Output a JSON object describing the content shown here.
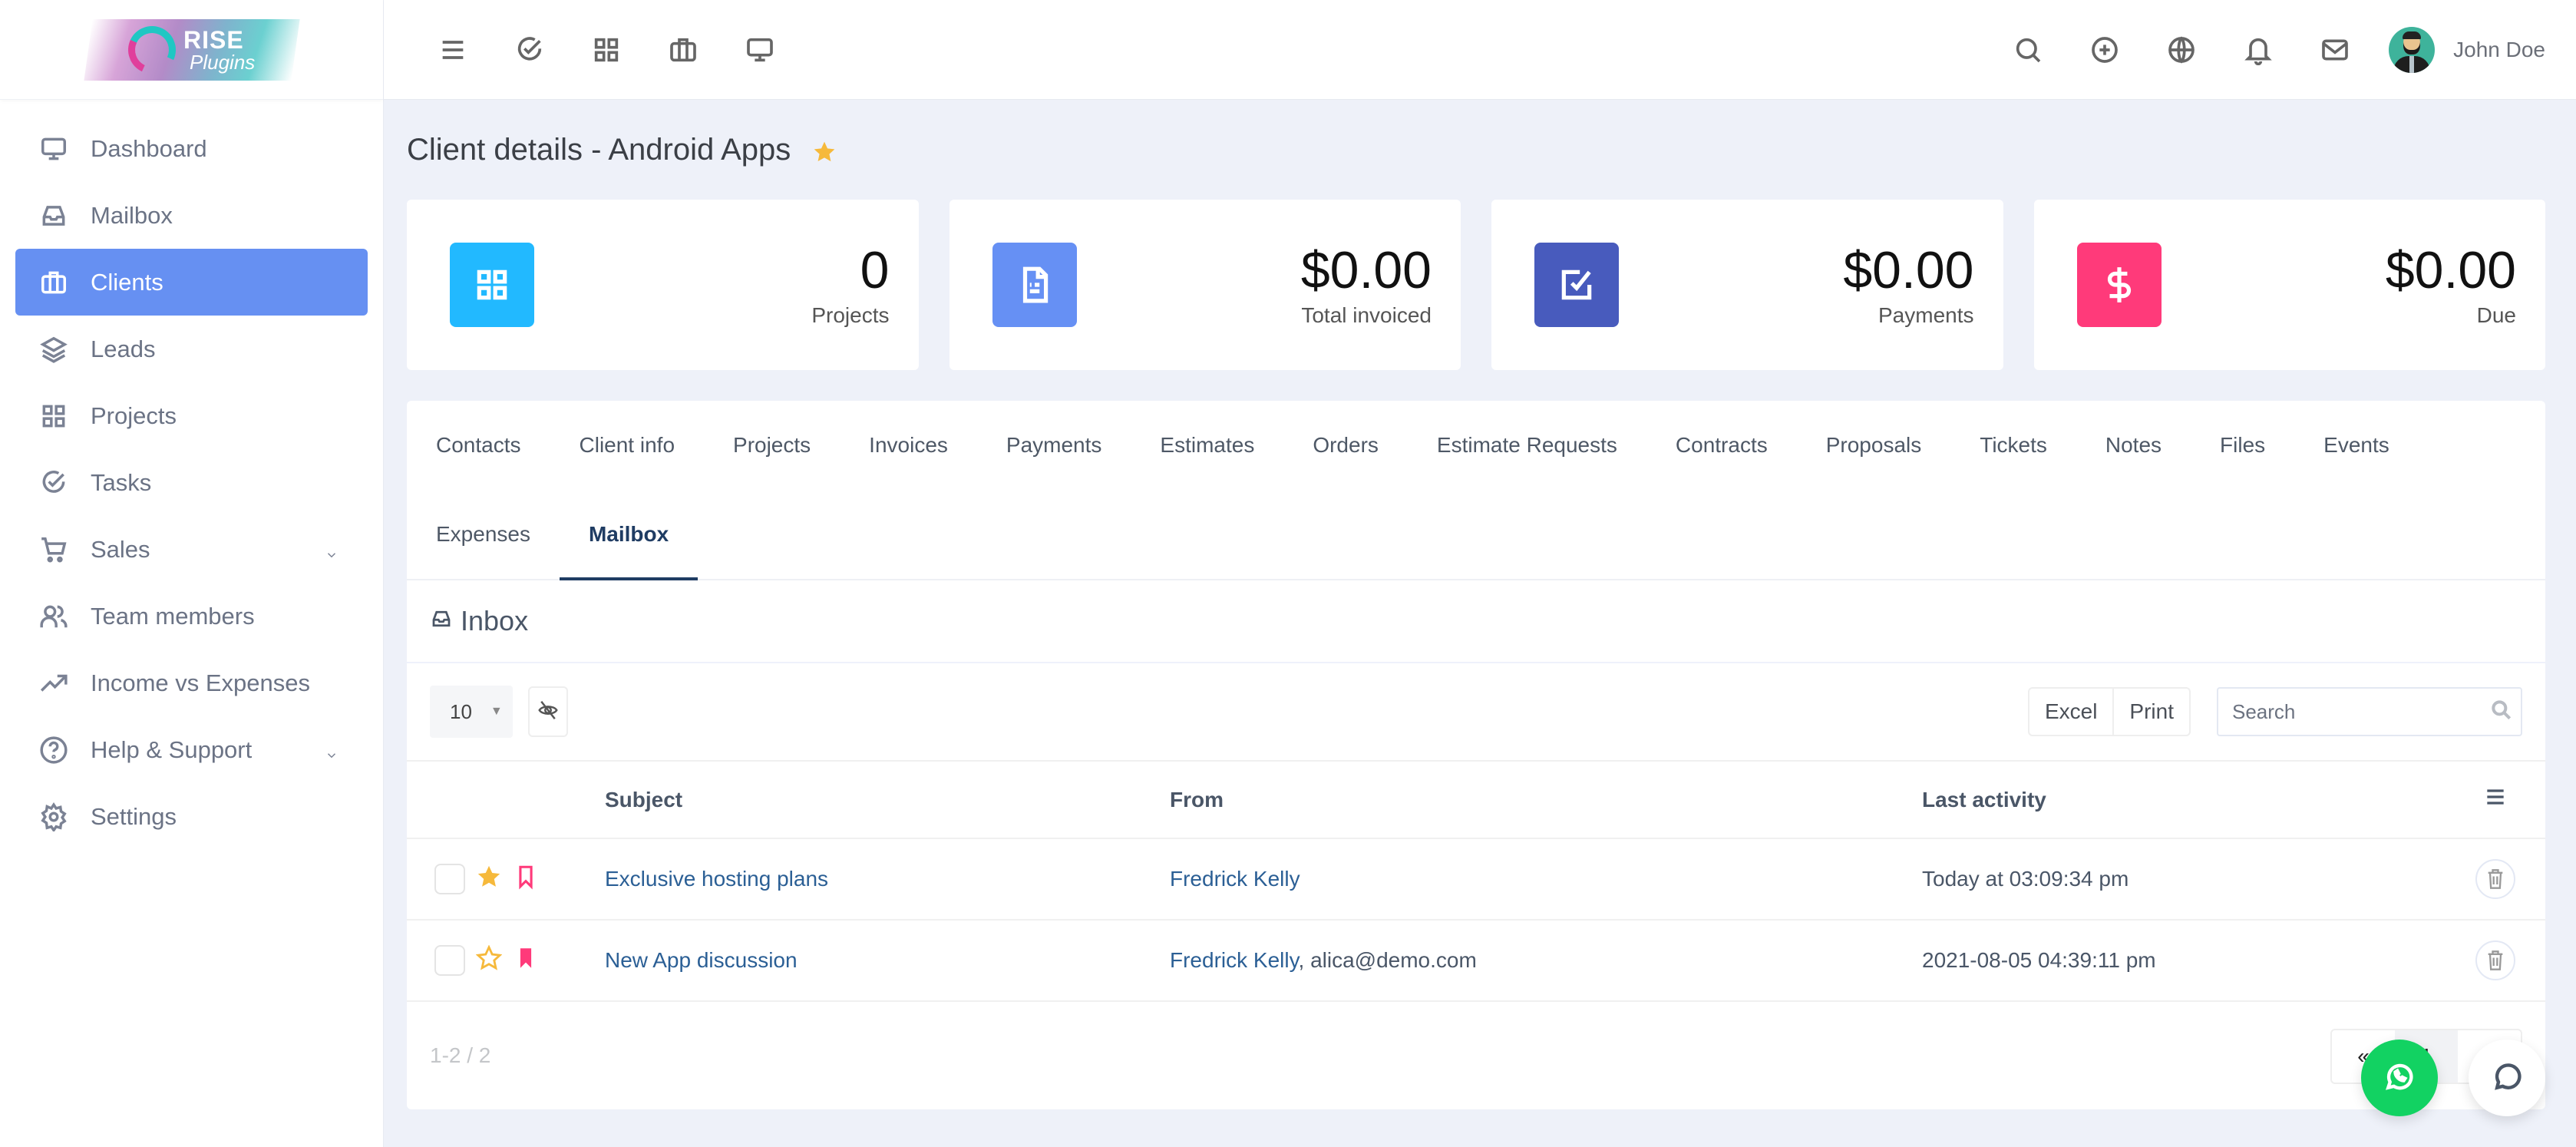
{
  "brand": {
    "line1": "RISE",
    "line2": "Plugins"
  },
  "sidebar": {
    "items": [
      {
        "label": "Dashboard",
        "icon": "monitor-icon",
        "active": false
      },
      {
        "label": "Mailbox",
        "icon": "inbox-icon",
        "active": false
      },
      {
        "label": "Clients",
        "icon": "briefcase-icon",
        "active": true
      },
      {
        "label": "Leads",
        "icon": "layers-icon",
        "active": false
      },
      {
        "label": "Projects",
        "icon": "grid-icon",
        "active": false
      },
      {
        "label": "Tasks",
        "icon": "check-circle-icon",
        "active": false
      },
      {
        "label": "Sales",
        "icon": "cart-icon",
        "active": false,
        "has_submenu": true
      },
      {
        "label": "Team members",
        "icon": "users-icon",
        "active": false
      },
      {
        "label": "Income vs Expenses",
        "icon": "trending-up-icon",
        "active": false
      },
      {
        "label": "Help & Support",
        "icon": "help-circle-icon",
        "active": false,
        "has_submenu": true
      },
      {
        "label": "Settings",
        "icon": "gear-icon",
        "active": false
      }
    ]
  },
  "topbar": {
    "left_icons": [
      "menu-icon",
      "check-circle-icon",
      "grid-icon",
      "briefcase-icon",
      "monitor-icon"
    ],
    "right_icons": [
      "search-icon",
      "plus-circle-icon",
      "globe-icon",
      "bell-icon",
      "mail-icon"
    ],
    "user_name": "John Doe"
  },
  "page": {
    "title": "Client details - Android Apps",
    "favorite": true
  },
  "stats": [
    {
      "value": "0",
      "label": "Projects",
      "icon": "grid-icon",
      "color": "#22b9ff"
    },
    {
      "value": "$0.00",
      "label": "Total invoiced",
      "icon": "file-text-icon",
      "color": "#6690f4"
    },
    {
      "value": "$0.00",
      "label": "Payments",
      "icon": "check-square-icon",
      "color": "#485bbd"
    },
    {
      "value": "$0.00",
      "label": "Due",
      "icon": "dollar-icon",
      "color": "#ff3a7a"
    }
  ],
  "tabs": [
    {
      "label": "Contacts",
      "active": false
    },
    {
      "label": "Client info",
      "active": false
    },
    {
      "label": "Projects",
      "active": false
    },
    {
      "label": "Invoices",
      "active": false
    },
    {
      "label": "Payments",
      "active": false
    },
    {
      "label": "Estimates",
      "active": false
    },
    {
      "label": "Orders",
      "active": false
    },
    {
      "label": "Estimate Requests",
      "active": false
    },
    {
      "label": "Contracts",
      "active": false
    },
    {
      "label": "Proposals",
      "active": false
    },
    {
      "label": "Tickets",
      "active": false
    },
    {
      "label": "Notes",
      "active": false
    },
    {
      "label": "Files",
      "active": false
    },
    {
      "label": "Events",
      "active": false
    },
    {
      "label": "Expenses",
      "active": false
    },
    {
      "label": "Mailbox",
      "active": true
    }
  ],
  "inbox": {
    "title": "Inbox",
    "page_size": "10",
    "excel_label": "Excel",
    "print_label": "Print",
    "search_placeholder": "Search",
    "columns": {
      "subject": "Subject",
      "from": "From",
      "last_activity": "Last activity"
    },
    "rows": [
      {
        "starred": true,
        "bookmarked": false,
        "subject": "Exclusive hosting plans",
        "from_name": "Fredrick Kelly",
        "from_extra": "",
        "last_activity": "Today at 03:09:34 pm"
      },
      {
        "starred": false,
        "bookmarked": true,
        "subject": "New App discussion",
        "from_name": "Fredrick Kelly",
        "from_extra": ", alica@demo.com",
        "last_activity": "2021-08-05 04:39:11 pm"
      }
    ],
    "info": "1-2 / 2",
    "pager": {
      "prev": "«",
      "current": "1",
      "next": "»"
    }
  },
  "colors": {
    "accent": "#6690f2",
    "active_tab": "#1f3c63",
    "link": "#2b5f95",
    "star": "#f6b93b",
    "bookmark": "#ff3a7a",
    "whatsapp": "#12d262"
  }
}
